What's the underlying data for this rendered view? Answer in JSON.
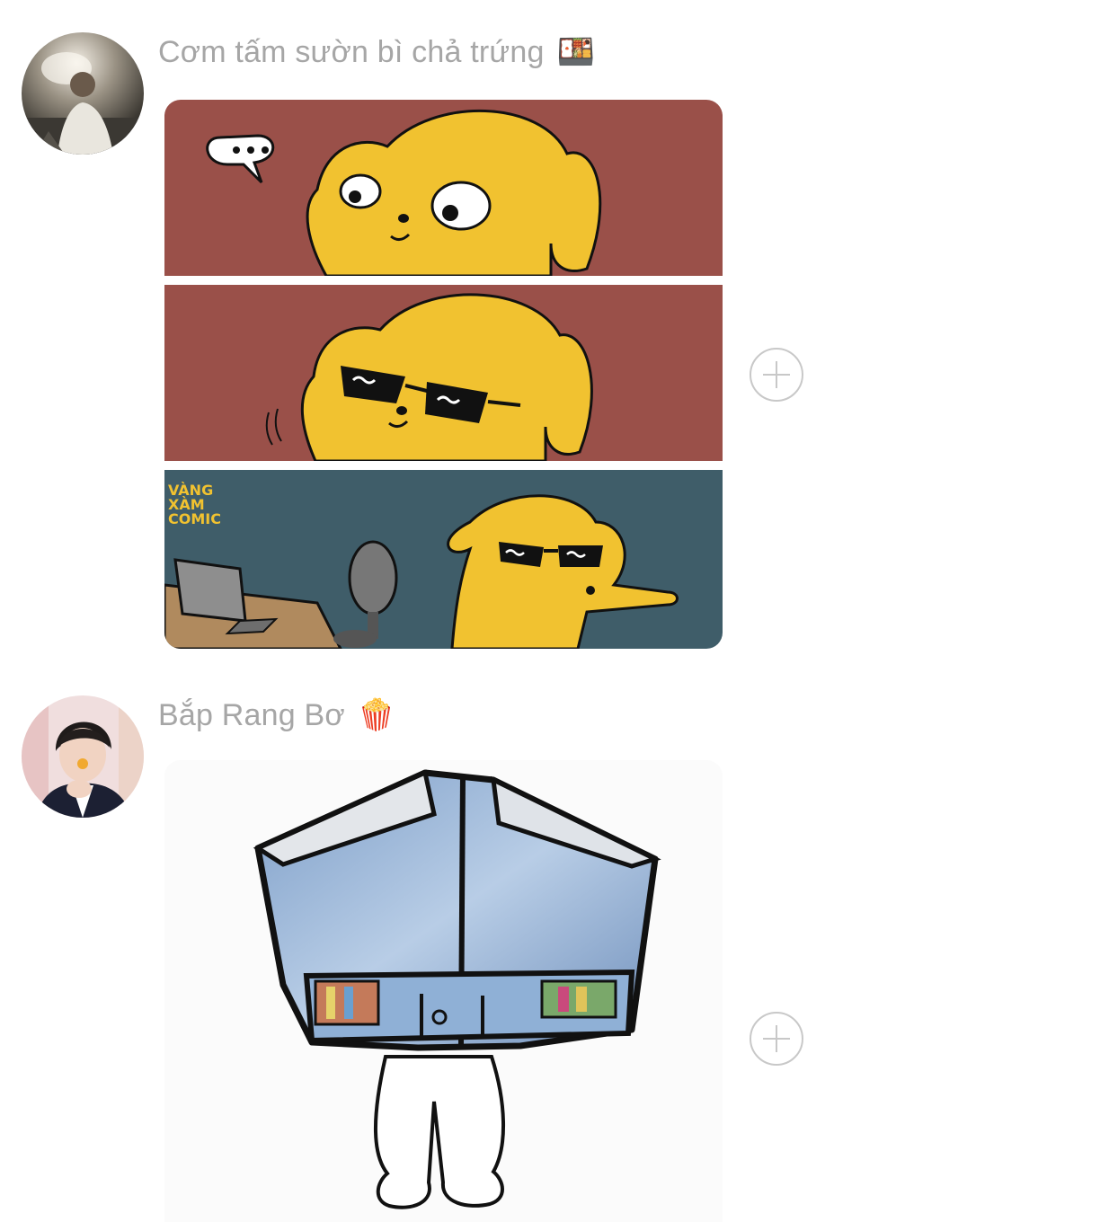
{
  "messages": [
    {
      "sender_name": "Cơm tấm sườn bì chả trứng",
      "sender_emoji": "🍱",
      "avatar_icon": "profile-photo-icon",
      "media": {
        "type": "comic-sticker",
        "watermark": "VÀNG XÀM COMIC",
        "speech_bubble": "..."
      },
      "add_icon": "plus-circle-icon"
    },
    {
      "sender_name": "Bắp Rang Bơ",
      "sender_emoji": "🍿",
      "avatar_icon": "profile-photo-icon",
      "media": {
        "type": "sticker-drawing"
      },
      "add_icon": "plus-circle-icon"
    }
  ],
  "colors": {
    "sender_text": "#a6a6a6",
    "add_button": "#c8c8c8",
    "panel_red": "#9a5049",
    "panel_teal": "#3f5d69",
    "dog_yellow": "#f1c230"
  }
}
